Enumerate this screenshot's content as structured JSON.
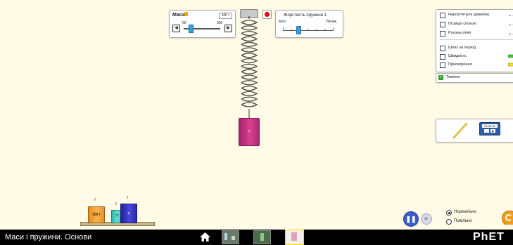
{
  "mass_control": {
    "label": "Маса",
    "value": "100 г",
    "min_label": "50",
    "max_label": "300",
    "level": 0.2
  },
  "spring_constant": {
    "label": "Жорсткість пружини 1",
    "min_label": "Мал.",
    "max_label": "Велик.",
    "level": 0.3
  },
  "hanging_mass": {
    "label": "?"
  },
  "options": {
    "items": [
      {
        "label": "Нерозтягнута довжина",
        "checked": false,
        "color": "#6a6aff"
      },
      {
        "label": "Позиція спокою",
        "checked": false,
        "color": "#2aa52a"
      },
      {
        "label": "Рухома лінія",
        "checked": false,
        "color": "#e02020"
      },
      {
        "label": "Шлях за період",
        "checked": false
      },
      {
        "label": "Швидкість",
        "checked": false,
        "color": "#3bc63b"
      },
      {
        "label": "Прискорення",
        "checked": false,
        "color": "#f0e020"
      }
    ]
  },
  "damping": {
    "label": "Тяжіння"
  },
  "timer": {
    "display": "00:00.00"
  },
  "masses": [
    {
      "label": "100 г",
      "hook": "?",
      "color": "#f7a53a"
    },
    {
      "label": "?",
      "hook": "?",
      "color": "#4fd0c4"
    },
    {
      "label": "?",
      "hook": "?",
      "color": "#3a3acc"
    }
  ],
  "sim_speed": {
    "normal": "Нормально",
    "slow": "Повільно",
    "selected": "normal"
  },
  "footer": {
    "title": "Маси і пружини. Основи",
    "brand": "PhET"
  }
}
